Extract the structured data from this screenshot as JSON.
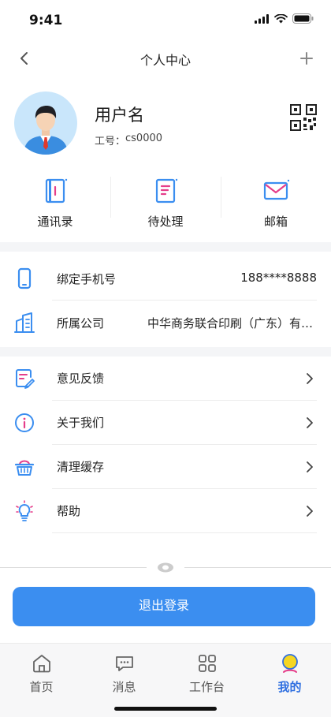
{
  "status_bar": {
    "time": "9:41"
  },
  "nav": {
    "title": "个人中心"
  },
  "profile": {
    "name": "用户名",
    "employee_id_label": "工号：",
    "employee_id": "cs0000"
  },
  "quick_actions": [
    {
      "label": "通讯录",
      "icon": "contacts-book-icon"
    },
    {
      "label": "待处理",
      "icon": "pending-document-icon"
    },
    {
      "label": "邮箱",
      "icon": "mail-envelope-icon"
    }
  ],
  "info": {
    "phone_label": "绑定手机号",
    "phone_value": "188****8888",
    "company_label": "所属公司",
    "company_value": "中华商务联合印刷（广东）有限公司"
  },
  "menu": [
    {
      "label": "意见反馈",
      "icon": "feedback-icon"
    },
    {
      "label": "关于我们",
      "icon": "info-icon"
    },
    {
      "label": "清理缓存",
      "icon": "basket-icon"
    },
    {
      "label": "帮助",
      "icon": "lightbulb-icon"
    }
  ],
  "logout_label": "退出登录",
  "tabs": [
    {
      "label": "首页",
      "icon": "home-icon"
    },
    {
      "label": "消息",
      "icon": "message-icon"
    },
    {
      "label": "工作台",
      "icon": "grid-icon"
    },
    {
      "label": "我的",
      "icon": "profile-icon",
      "active": true
    }
  ],
  "colors": {
    "accent": "#3b8ef0",
    "tab_active": "#2f6fe0",
    "section_gap": "#f4f5f7"
  }
}
